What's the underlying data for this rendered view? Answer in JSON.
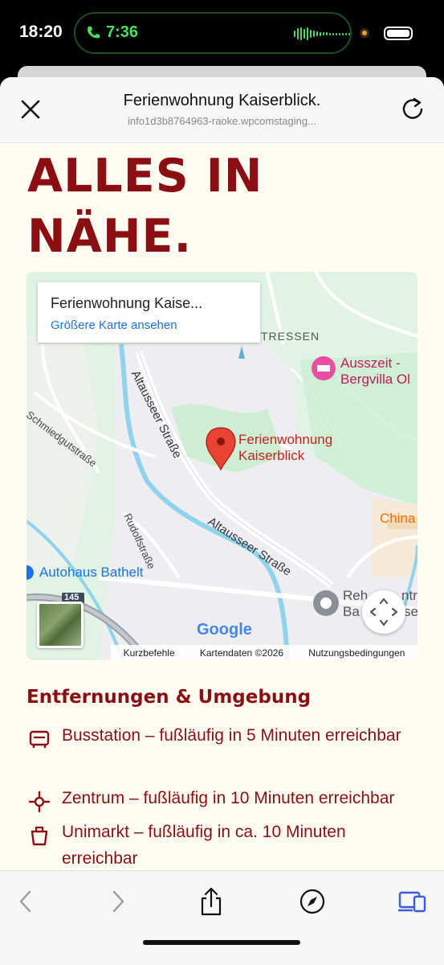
{
  "status_bar": {
    "time": "18:20",
    "call_time": "7:36"
  },
  "browser": {
    "page_title": "Ferienwohnung Kaiserblick.",
    "url": "info1d3b8764963-raoke.wpcomstaging..."
  },
  "page": {
    "headline_line1": "ALLES IN",
    "headline_line2": "NÄHE.",
    "section_title": "Entfernungen & Umgebung",
    "items": [
      {
        "icon": "bus-icon",
        "text": "Busstation – fußläufig in 5 Minuten erreichbar"
      },
      {
        "icon": "center-target-icon",
        "text": "Zentrum – fußläufig in 10 Minuten erreichbar"
      },
      {
        "icon": "shopping-basket-icon",
        "text": "Unimarkt – fußläufig in ca. 10 Minuten erreichbar"
      }
    ]
  },
  "map": {
    "info_card_title": "Ferienwohnung Kaise...",
    "info_card_link": "Größere Karte ansehen",
    "labels": {
      "tressen": "TRESSEN",
      "ausszeit_1": "Ausszeit -",
      "ausszeit_2": "Bergvilla Ol",
      "schmiedgut": "Schmiedgutstraße",
      "altausseer_1": "Altausseer Straße",
      "altausseer_2": "Altausseer Straße",
      "marker_1": "Ferienwohnung",
      "marker_2": "Kaiserblick",
      "china": "China",
      "rudolf": "Rudolfstraße",
      "autohaus": "Autohaus Bathelt",
      "road_shield": "145",
      "reh_1": "Reh",
      "reh_2": "Ba",
      "ntr": "ntr",
      "se": "se",
      "google": "Google"
    },
    "footer": {
      "shortcuts": "Kurzbefehle",
      "map_data": "Kartendaten ©2026",
      "terms": "Nutzungsbedingungen"
    },
    "colors": {
      "marker": "#ea4335",
      "water": "#7fcfe6",
      "green": "#cdeed2"
    }
  },
  "colors": {
    "brand_red": "#8b0f12",
    "page_bg": "#fffdf2",
    "link_blue": "#1a73e8"
  }
}
